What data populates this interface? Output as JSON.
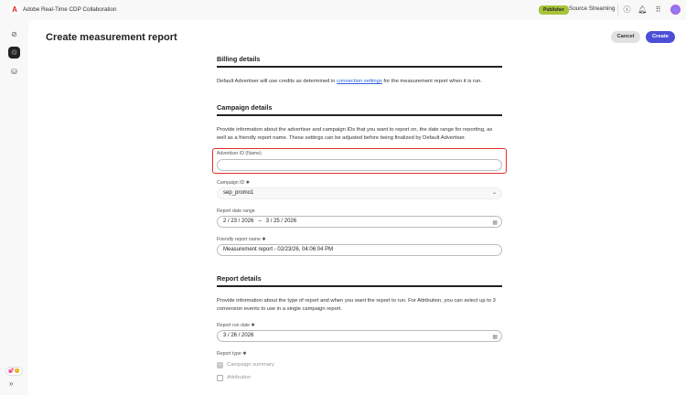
{
  "header": {
    "app_title": "Adobe Real-Time CDP Collaboration",
    "badge": "Publisher",
    "source": "Source Streaming"
  },
  "page": {
    "title": "Create measurement report",
    "cancel": "Cancel",
    "create": "Create"
  },
  "billing": {
    "heading": "Billing details",
    "text_before": "Default Advertiser will use credits as determined in ",
    "link": "connection settings",
    "text_after": " for the measurement report when it is run."
  },
  "campaign": {
    "heading": "Campaign details",
    "description": "Provide information about the advertiser and campaign IDs that you want to report on, the date range for reporting, as well as a friendly report name. These settings can be adjusted before being finalized by Default Advertiser.",
    "advertiser_label": "Advertiser ID (Name)",
    "advertiser_value": "",
    "campaign_label": "Campaign ID",
    "campaign_value": "sep_promo1",
    "date_label": "Report date range",
    "date_start": "2 / 23 / 2026",
    "date_sep": "–",
    "date_end": "3 / 25 / 2026",
    "name_label": "Friendly report name",
    "name_value": "Measurement report - 02/23/26, 04:06:04 PM"
  },
  "report": {
    "heading": "Report details",
    "description": "Provide information about the type of report and when you want the report to run. For Attribution, you can select up to 3 conversion events to use in a single campaign report.",
    "run_label": "Report run date",
    "run_value": "3 / 26 / 2026",
    "type_label": "Report type",
    "types": [
      {
        "label": "Campaign summary",
        "checked": true
      },
      {
        "label": "Attribution",
        "checked": false
      }
    ]
  },
  "required_mark": "✱"
}
